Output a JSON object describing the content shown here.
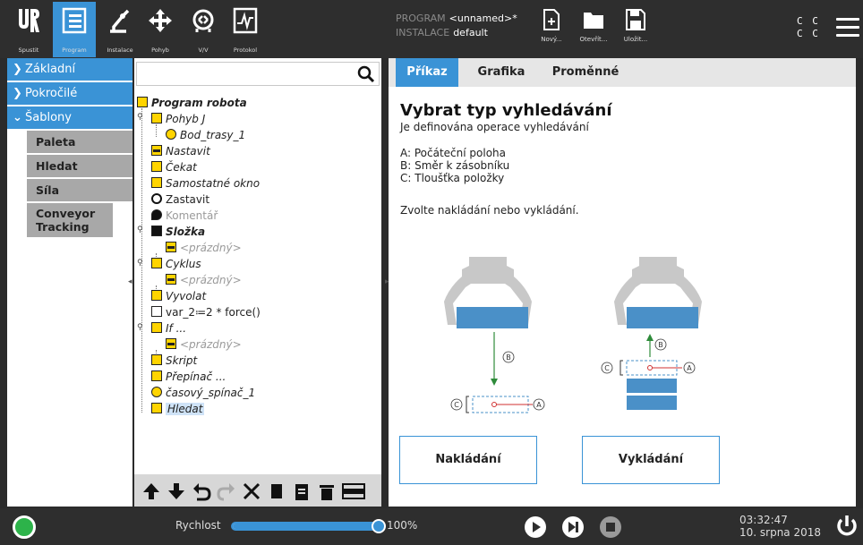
{
  "header": {
    "nav": [
      {
        "label": "Spustit",
        "icon": "ur-logo-icon"
      },
      {
        "label": "Program",
        "icon": "program-icon",
        "active": true
      },
      {
        "label": "Instalace",
        "icon": "robot-arm-icon"
      },
      {
        "label": "Pohyb",
        "icon": "move-cross-icon"
      },
      {
        "label": "V/V",
        "icon": "io-icon"
      },
      {
        "label": "Protokol",
        "icon": "log-chart-icon"
      }
    ],
    "program_key": "PROGRAM",
    "program_value": "<unnamed>*",
    "install_key": "INSTALACE",
    "install_value": "default",
    "file_buttons": [
      {
        "label": "Nový...",
        "icon": "new-file-icon"
      },
      {
        "label": "Otevřít...",
        "icon": "folder-icon"
      },
      {
        "label": "Uložit...",
        "icon": "save-icon"
      }
    ],
    "cc_line1": "C C",
    "cc_line2": "C C",
    "menu_icon": "hamburger-menu-icon"
  },
  "sidebar": {
    "items": [
      {
        "label": "Základní",
        "expanded": false
      },
      {
        "label": "Pokročilé",
        "expanded": false
      },
      {
        "label": "Šablony",
        "expanded": true
      }
    ],
    "sub_items": [
      "Paleta",
      "Hledat",
      "Síla",
      "Conveyor Tracking"
    ]
  },
  "tree": {
    "search_value": "",
    "nodes": [
      {
        "text": "Program robota",
        "icon": "yellow-triangle-icon",
        "style": "bold-italic"
      },
      {
        "text": "Pohyb J",
        "icon": "move-icon",
        "style": "italic"
      },
      {
        "text": "Bod_trasy_1",
        "icon": "waypoint-icon",
        "style": "italic"
      },
      {
        "text": "Nastavit",
        "icon": "set-icon",
        "style": "italic"
      },
      {
        "text": "Čekat",
        "icon": "hourglass-icon",
        "style": "italic"
      },
      {
        "text": "Samostatné okno",
        "icon": "popup-icon",
        "style": "italic"
      },
      {
        "text": "Zastavit",
        "icon": "stop-hand-icon",
        "style": "normal"
      },
      {
        "text": "Komentář",
        "icon": "comment-icon",
        "style": "dim"
      },
      {
        "text": "Složka",
        "icon": "folder-icon",
        "style": "bold-italic"
      },
      {
        "text": "<prázdný>",
        "icon": "empty-icon",
        "style": "dim-italic"
      },
      {
        "text": "Cyklus",
        "icon": "loop-icon",
        "style": "italic"
      },
      {
        "text": "<prázdný>",
        "icon": "empty-icon",
        "style": "dim-italic"
      },
      {
        "text": "Vyvolat",
        "icon": "call-icon",
        "style": "italic"
      },
      {
        "text": "var_2≔2 * force()",
        "icon": "assign-icon",
        "style": "normal"
      },
      {
        "text": "If ...",
        "icon": "if-icon",
        "style": "italic"
      },
      {
        "text": "<prázdný>",
        "icon": "empty-icon",
        "style": "dim-italic"
      },
      {
        "text": "Skript",
        "icon": "script-icon",
        "style": "italic"
      },
      {
        "text": "Přepínač ...",
        "icon": "switch-icon",
        "style": "italic"
      },
      {
        "text": "časový_spínač_1",
        "icon": "timer-icon",
        "style": "italic"
      },
      {
        "text": "Hledat",
        "icon": "search-template-icon",
        "style": "italic-selected"
      }
    ],
    "toolbar": [
      "move-up-icon",
      "move-down-icon",
      "undo-icon",
      "redo-icon",
      "cut-icon",
      "copy-icon",
      "paste-icon",
      "delete-icon",
      "suppress-icon"
    ]
  },
  "main": {
    "tabs": [
      {
        "label": "Příkaz",
        "active": true
      },
      {
        "label": "Grafika",
        "active": false
      },
      {
        "label": "Proměnné",
        "active": false
      }
    ],
    "title": "Vybrat typ vyhledávání",
    "subtitle": "Je definována operace vyhledávání",
    "legend": [
      "A: Počáteční poloha",
      "B: Směr k zásobníku",
      "C: Tloušťka položky"
    ],
    "instruction": "Zvolte nakládání nebo vykládání.",
    "diagram_labels": {
      "a": "A",
      "b": "B",
      "c": "C"
    },
    "buttons": {
      "stacking": "Nakládání",
      "destacking": "Vykládání"
    }
  },
  "footer": {
    "speed_label": "Rychlost",
    "speed_value": "100%",
    "speed_fraction": 1.0,
    "time": "03:32:47",
    "date": "10. srpna 2018"
  },
  "colors": {
    "accent": "#3a93d6",
    "status_green": "#2db34a",
    "icon_yellow": "#ffd400"
  }
}
